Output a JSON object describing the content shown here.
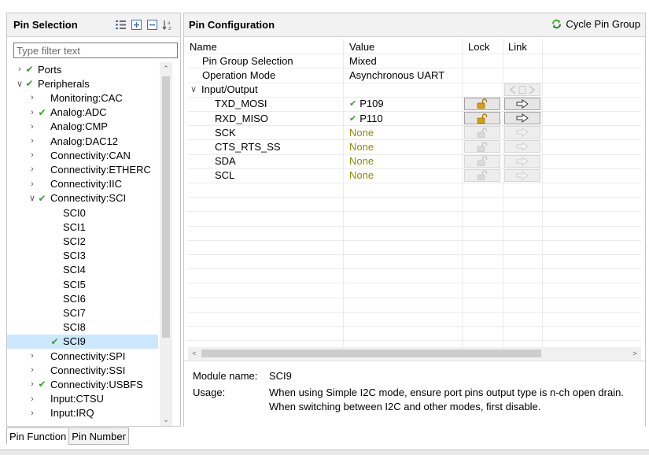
{
  "left_panel": {
    "title": "Pin Selection",
    "icons": [
      "flat-list-icon",
      "expand-all-icon",
      "collapse-all-icon",
      "sort-az-icon"
    ],
    "filter_placeholder": "Type filter text",
    "tree": [
      {
        "label": "Ports",
        "checked": true,
        "expander": "collapsed",
        "indent": 0
      },
      {
        "label": "Peripherals",
        "checked": true,
        "expander": "expanded",
        "indent": 0
      },
      {
        "label": "Monitoring:CAC",
        "checked": false,
        "expander": "collapsed",
        "indent": 1
      },
      {
        "label": "Analog:ADC",
        "checked": true,
        "expander": "collapsed",
        "indent": 1
      },
      {
        "label": "Analog:CMP",
        "checked": false,
        "expander": "collapsed",
        "indent": 1
      },
      {
        "label": "Analog:DAC12",
        "checked": false,
        "expander": "collapsed",
        "indent": 1
      },
      {
        "label": "Connectivity:CAN",
        "checked": false,
        "expander": "collapsed",
        "indent": 1
      },
      {
        "label": "Connectivity:ETHERC",
        "checked": false,
        "expander": "collapsed",
        "indent": 1
      },
      {
        "label": "Connectivity:IIC",
        "checked": false,
        "expander": "collapsed",
        "indent": 1
      },
      {
        "label": "Connectivity:SCI",
        "checked": true,
        "expander": "expanded",
        "indent": 1
      },
      {
        "label": "SCI0",
        "checked": false,
        "expander": "none",
        "indent": 2
      },
      {
        "label": "SCI1",
        "checked": false,
        "expander": "none",
        "indent": 2
      },
      {
        "label": "SCI2",
        "checked": false,
        "expander": "none",
        "indent": 2
      },
      {
        "label": "SCI3",
        "checked": false,
        "expander": "none",
        "indent": 2
      },
      {
        "label": "SCI4",
        "checked": false,
        "expander": "none",
        "indent": 2
      },
      {
        "label": "SCI5",
        "checked": false,
        "expander": "none",
        "indent": 2
      },
      {
        "label": "SCI6",
        "checked": false,
        "expander": "none",
        "indent": 2
      },
      {
        "label": "SCI7",
        "checked": false,
        "expander": "none",
        "indent": 2
      },
      {
        "label": "SCI8",
        "checked": false,
        "expander": "none",
        "indent": 2
      },
      {
        "label": "SCI9",
        "checked": true,
        "expander": "none",
        "indent": 2,
        "selected": true
      },
      {
        "label": "Connectivity:SPI",
        "checked": false,
        "expander": "collapsed",
        "indent": 1
      },
      {
        "label": "Connectivity:SSI",
        "checked": false,
        "expander": "collapsed",
        "indent": 1
      },
      {
        "label": "Connectivity:USBFS",
        "checked": true,
        "expander": "collapsed",
        "indent": 1
      },
      {
        "label": "Input:CTSU",
        "checked": false,
        "expander": "collapsed",
        "indent": 1
      },
      {
        "label": "Input:IRQ",
        "checked": false,
        "expander": "collapsed",
        "indent": 1
      }
    ]
  },
  "bottom_tabs": [
    "Pin Function",
    "Pin Number"
  ],
  "right_panel": {
    "title": "Pin Configuration",
    "cycle_button": "Cycle Pin Group",
    "columns": [
      "Name",
      "Value",
      "Lock",
      "Link"
    ],
    "rows": [
      {
        "name": "Pin Group Selection",
        "value": "Mixed",
        "value_style": "normal",
        "indent": 1,
        "lock": "none",
        "link": "none"
      },
      {
        "name": "Operation Mode",
        "value": "Asynchronous UART",
        "value_style": "normal",
        "indent": 1,
        "lock": "none",
        "link": "none"
      },
      {
        "name": "Input/Output",
        "value": "",
        "value_style": "normal",
        "indent": 0,
        "expander": "expanded",
        "lock": "none",
        "link": "group"
      },
      {
        "name": "TXD_MOSI",
        "value": "P109",
        "value_style": "checked",
        "indent": 2,
        "lock": "enabled",
        "link": "enabled"
      },
      {
        "name": "RXD_MISO",
        "value": "P110",
        "value_style": "checked",
        "indent": 2,
        "lock": "enabled",
        "link": "enabled"
      },
      {
        "name": "SCK",
        "value": "None",
        "value_style": "none",
        "indent": 2,
        "lock": "disabled",
        "link": "disabled"
      },
      {
        "name": "CTS_RTS_SS",
        "value": "None",
        "value_style": "none",
        "indent": 2,
        "lock": "disabled",
        "link": "disabled"
      },
      {
        "name": "SDA",
        "value": "None",
        "value_style": "none",
        "indent": 2,
        "lock": "disabled",
        "link": "disabled"
      },
      {
        "name": "SCL",
        "value": "None",
        "value_style": "none",
        "indent": 2,
        "lock": "disabled",
        "link": "disabled"
      }
    ],
    "info": {
      "module_label": "Module name:",
      "module_value": "SCI9",
      "usage_label": "Usage:",
      "usage_lines": [
        "When using Simple I2C mode, ensure port pins output type is n-ch open drain.",
        "When switching between I2C and other modes, first disable."
      ]
    }
  },
  "colors": {
    "check_green": "#3d9b35",
    "none_value": "#8c8c00",
    "selection": "#cce8ff",
    "lock_gold": "#d4a017"
  }
}
